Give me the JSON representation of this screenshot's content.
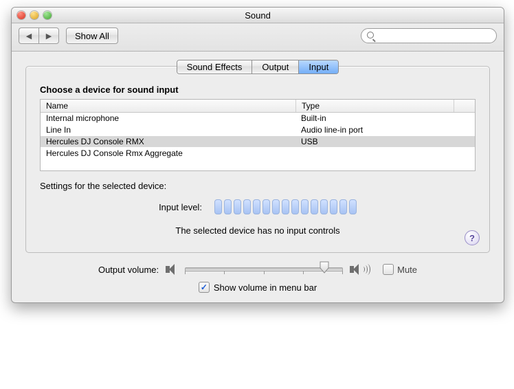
{
  "window": {
    "title": "Sound"
  },
  "toolbar": {
    "back_glyph": "◀",
    "fwd_glyph": "▶",
    "show_all_label": "Show All"
  },
  "tabs": [
    {
      "label": "Sound Effects",
      "selected": false
    },
    {
      "label": "Output",
      "selected": false
    },
    {
      "label": "Input",
      "selected": true
    }
  ],
  "pane": {
    "heading": "Choose a device for sound input",
    "columns": {
      "name": "Name",
      "type": "Type"
    },
    "devices": [
      {
        "name": "Internal microphone",
        "type": "Built-in",
        "selected": false
      },
      {
        "name": "Line In",
        "type": "Audio line-in port",
        "selected": false
      },
      {
        "name": "Hercules DJ Console RMX",
        "type": "USB",
        "selected": true
      },
      {
        "name": "Hercules DJ Console Rmx Aggregate",
        "type": "",
        "selected": false
      }
    ],
    "settings_label": "Settings for the selected device:",
    "input_level_label": "Input level:",
    "input_level_bars": 15,
    "no_controls_msg": "The selected device has no input controls",
    "help_glyph": "?"
  },
  "footer": {
    "output_volume_label": "Output volume:",
    "volume_percent": 88,
    "mute_label": "Mute",
    "mute_checked": false,
    "menubar_label": "Show volume in menu bar",
    "menubar_checked": true
  }
}
